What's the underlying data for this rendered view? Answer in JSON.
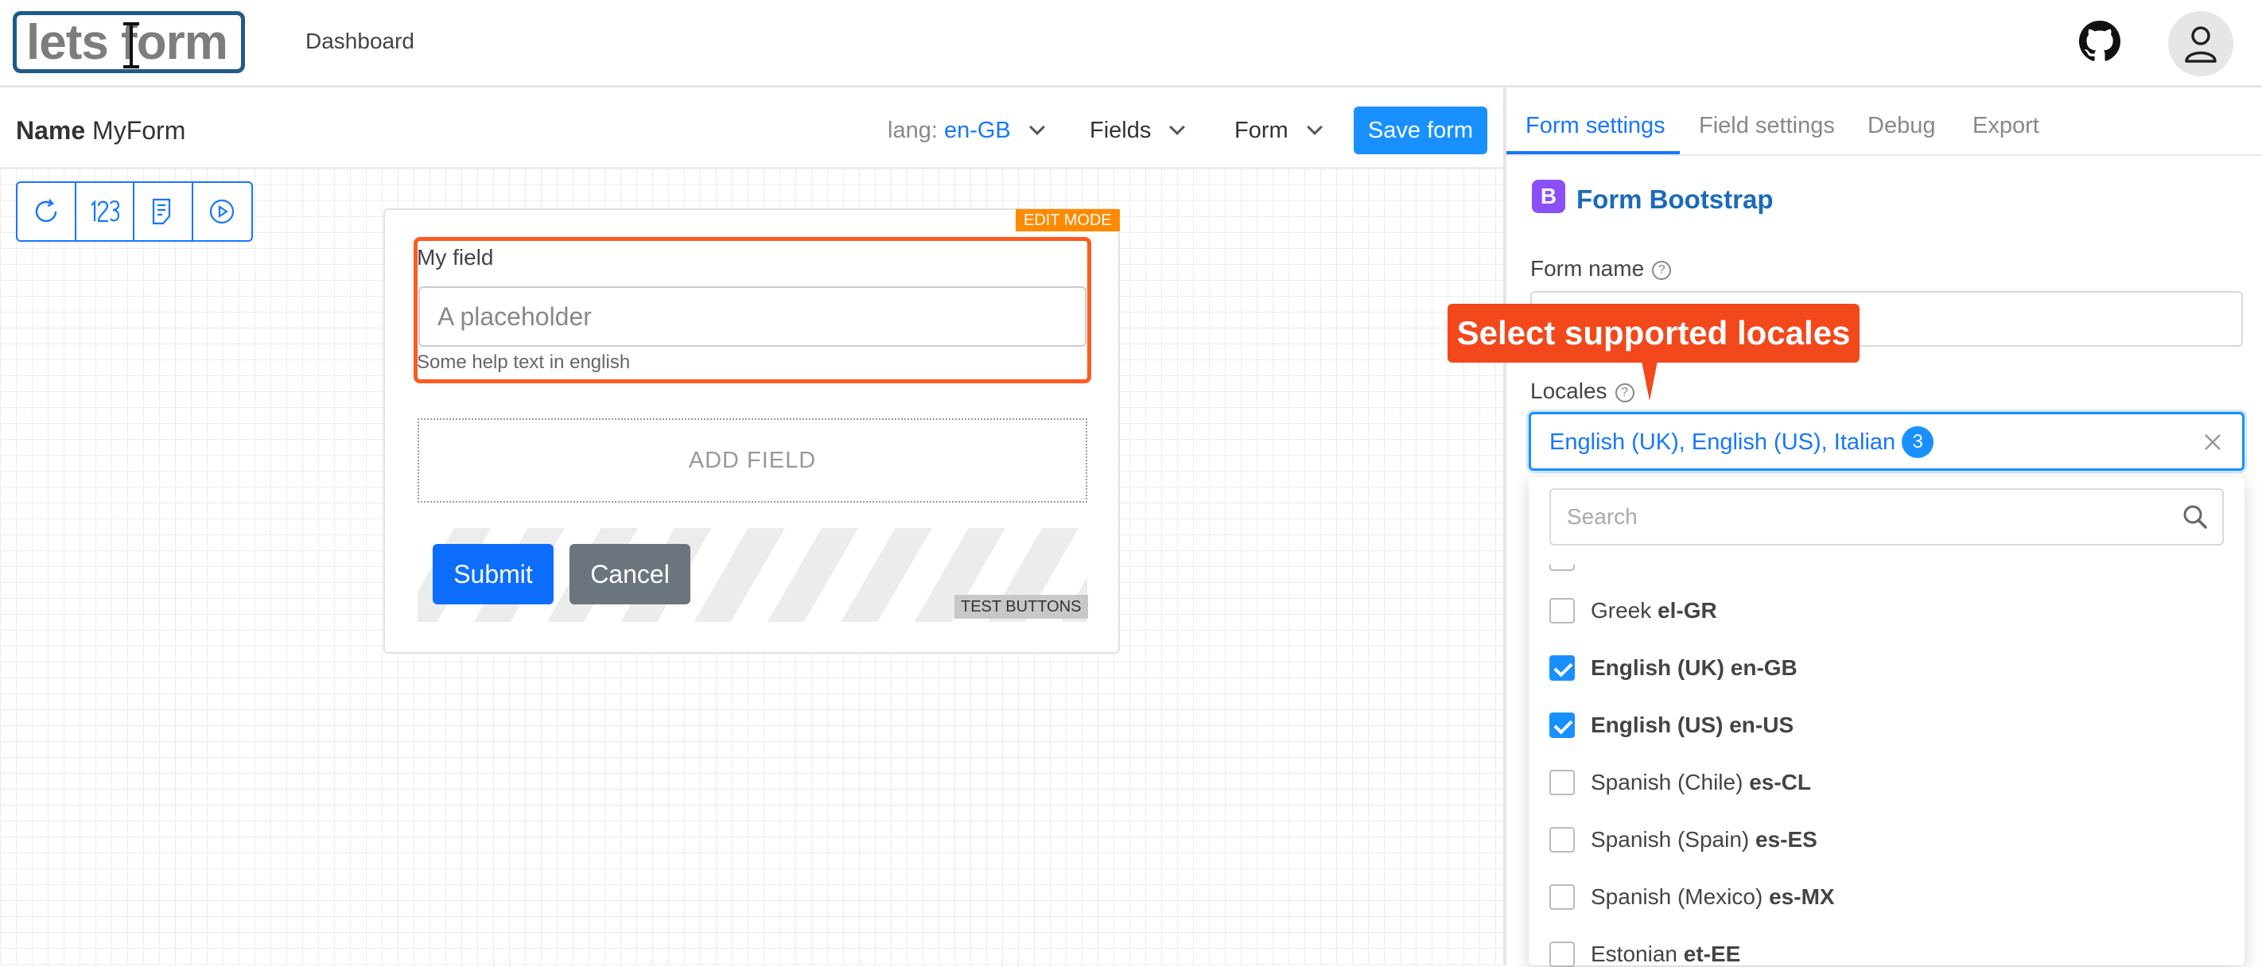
{
  "header": {
    "logo_text": "lets form",
    "nav": {
      "dashboard": "Dashboard"
    }
  },
  "toolbar": {
    "name_label": "Name",
    "form_name": "MyForm",
    "lang_label": "lang:",
    "lang_value": "en-GB",
    "fields_menu": "Fields",
    "form_menu": "Form",
    "save_label": "Save form"
  },
  "canvas": {
    "edit_mode_badge": "EDIT MODE",
    "field": {
      "label": "My field",
      "placeholder": "A placeholder",
      "help": "Some help text in english"
    },
    "add_field": "ADD FIELD",
    "submit_label": "Submit",
    "cancel_label": "Cancel",
    "test_buttons_badge": "TEST BUTTONS"
  },
  "panel": {
    "tabs": [
      {
        "label": "Form settings",
        "active": true
      },
      {
        "label": "Field settings",
        "active": false
      },
      {
        "label": "Debug",
        "active": false
      },
      {
        "label": "Export",
        "active": false
      }
    ],
    "framework_icon": "B",
    "framework_title": "Form Bootstrap",
    "form_name_label": "Form name",
    "locales_label": "Locales",
    "help_icon": "?",
    "locales_value": "English (UK), English (US), Italian",
    "locales_count": "3",
    "search_placeholder": "Search",
    "options": [
      {
        "name": "Greek",
        "code": "el-GR",
        "checked": false
      },
      {
        "name": "English (UK)",
        "code": "en-GB",
        "checked": true
      },
      {
        "name": "English (US)",
        "code": "en-US",
        "checked": true
      },
      {
        "name": "Spanish (Chile)",
        "code": "es-CL",
        "checked": false
      },
      {
        "name": "Spanish (Spain)",
        "code": "es-ES",
        "checked": false
      },
      {
        "name": "Spanish (Mexico)",
        "code": "es-MX",
        "checked": false
      },
      {
        "name": "Estonian",
        "code": "et-EE",
        "checked": false
      }
    ]
  },
  "tooltip": {
    "text": "Select supported locales"
  },
  "colors": {
    "primary": "#1677ff",
    "accent": "#f2481c",
    "edit_mode": "#ff8a00"
  }
}
